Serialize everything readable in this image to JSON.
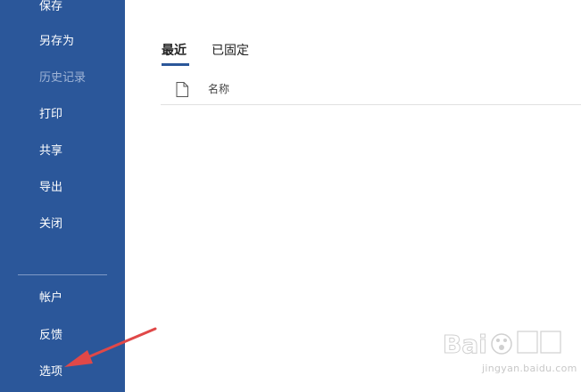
{
  "sidebar": {
    "items": [
      {
        "label": "保存"
      },
      {
        "label": "另存为"
      },
      {
        "label": "历史记录"
      },
      {
        "label": "打印"
      },
      {
        "label": "共享"
      },
      {
        "label": "导出"
      },
      {
        "label": "关闭"
      },
      {
        "label": "帐户"
      },
      {
        "label": "反馈"
      },
      {
        "label": "选项"
      }
    ]
  },
  "main": {
    "tabs": [
      {
        "label": "最近"
      },
      {
        "label": "已固定"
      }
    ],
    "list_header": {
      "name_label": "名称"
    }
  },
  "colors": {
    "sidebar_bg": "#2b579a",
    "annotation_arrow": "#e04848"
  },
  "icons": {
    "file": "file-icon"
  }
}
